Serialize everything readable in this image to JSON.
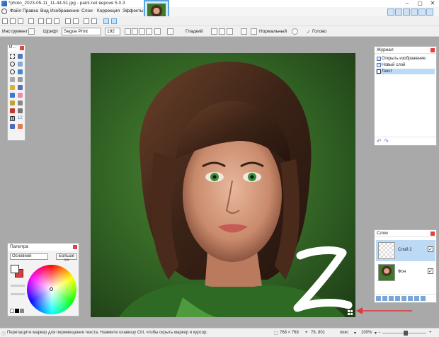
{
  "window": {
    "title": "*photo_2023-05-11_11-44-51.jpg - paint.net версия 5.0.3",
    "controls": [
      "–",
      "▢",
      "✕"
    ]
  },
  "menu": {
    "items": [
      "Файл",
      "Правка",
      "Вид",
      "Изображение",
      "Слои",
      "Коррекция",
      "Эффекты"
    ]
  },
  "toolbar2": {
    "tool_label": "Инструмент",
    "font_label": "Шрифт",
    "font_value": "Segoe Print",
    "size_value": "192",
    "antialias": "Гладкий",
    "blend_mode": "Нормальный",
    "finish": "Готово"
  },
  "tools_panel": {
    "title": "И..."
  },
  "palette": {
    "title": "Палитра",
    "select_value": "Основной",
    "more_button": "Больше >>"
  },
  "journal": {
    "title": "Журнал",
    "items": [
      {
        "label": "Открыть изображение",
        "selected": false
      },
      {
        "label": "Новый слой",
        "selected": false
      },
      {
        "label": "Текст",
        "selected": true
      }
    ]
  },
  "layers": {
    "title": "Слои",
    "items": [
      {
        "label": "Слой 2",
        "selected": true,
        "visible": true
      },
      {
        "label": "Фон",
        "selected": false,
        "visible": true
      }
    ]
  },
  "canvas": {
    "text": "Z"
  },
  "statusbar": {
    "hint": "Перетащите маркер для перемещения текста. Нажмите клавишу Ctrl, чтобы скрыть маркер и курсор.",
    "image_size": "768 × 768",
    "cursor_pos": "78, 801",
    "units": "пикс",
    "zoom": "100%"
  },
  "colors": {
    "accent": "#5aa4e0",
    "selection": "#bcd9f5",
    "arrow": "#e0363b",
    "close": "#e04343"
  }
}
